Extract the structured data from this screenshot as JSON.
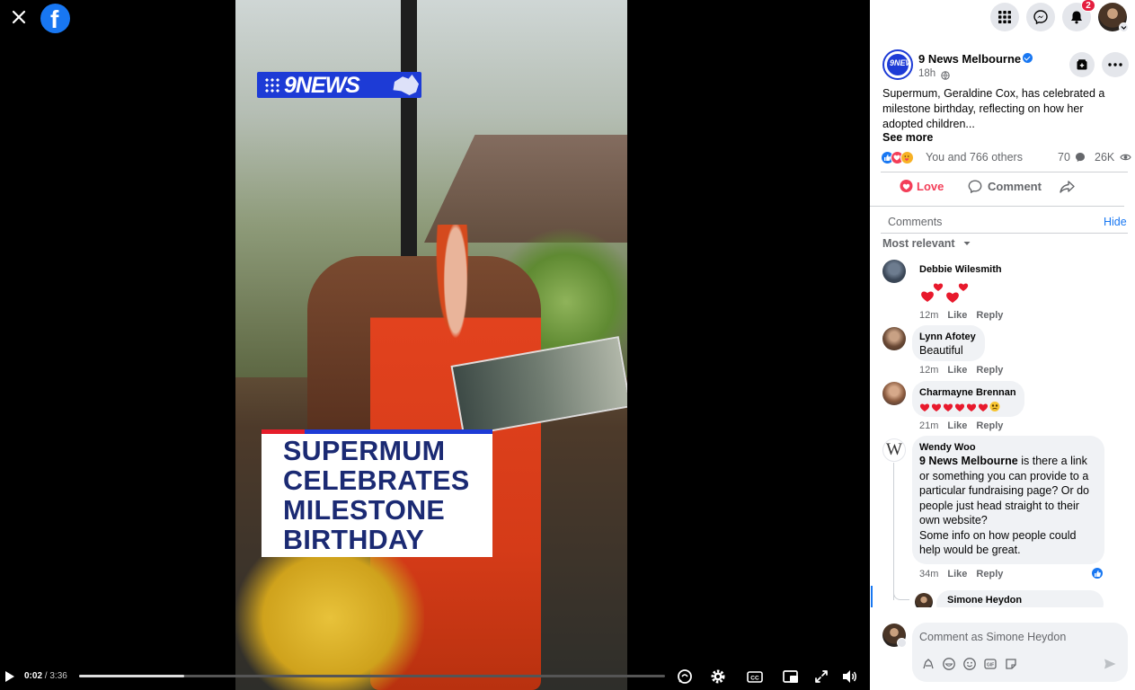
{
  "viewer": {
    "video": {
      "brand_text": "9NEWS",
      "headline": "SUPERMUM CELEBRATES MILESTONE BIRTHDAY",
      "current_time": "0:02",
      "separator": " / ",
      "duration": "3:36",
      "progress_fraction": 0.18
    }
  },
  "topbar": {
    "notification_count": "2"
  },
  "post": {
    "page_name": "9 News Melbourne",
    "avatar_text": "9NEWS",
    "time": "18h",
    "caption": "Supermum, Geraldine Cox, has celebrated a milestone birthday, reflecting on how her adopted children...",
    "see_more": "See more",
    "reactions_text": "You and 766 others",
    "comments_count": "70",
    "views_count": "26K",
    "actions": {
      "love": "Love",
      "comment": "Comment"
    }
  },
  "comments_section": {
    "header": "Comments",
    "hide": "Hide",
    "sort": "Most relevant",
    "items": [
      {
        "name": "Debbie Wilesmith",
        "body": "",
        "time": "12m",
        "like": "Like",
        "reply": "Reply"
      },
      {
        "name": "Lynn Afotey",
        "body": "Beautiful",
        "time": "12m",
        "like": "Like",
        "reply": "Reply"
      },
      {
        "name": "Charmayne Brennan",
        "body": "",
        "time": "21m",
        "like": "Like",
        "reply": "Reply"
      },
      {
        "name": "Wendy Woo",
        "mention": "9 News Melbourne",
        "body": " is there a link or something you can provide to a particular fundraising page? Or do people just head straight to their own website?",
        "body2": "Some info on how people could help would be great.",
        "time": "34m",
        "like": "Like",
        "reply": "Reply",
        "avatar_letter": "W"
      },
      {
        "name": "Simone Heydon"
      }
    ],
    "composer_placeholder": "Comment as Simone Heydon"
  },
  "colors": {
    "fb_blue": "#1877f2",
    "love_red": "#f33e58",
    "nine_blue": "#1d3bd6",
    "headline_navy": "#1b2a73"
  }
}
